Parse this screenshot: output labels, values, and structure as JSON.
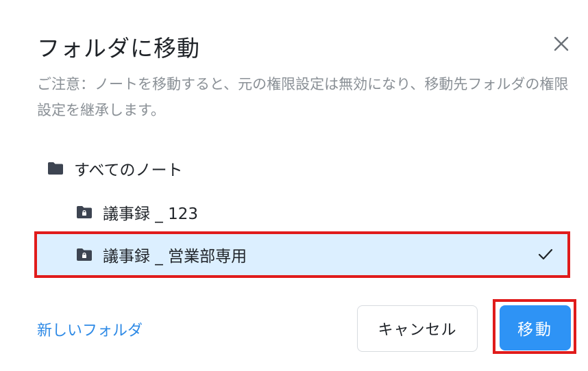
{
  "dialog": {
    "title": "フォルダに移動",
    "notice": "ご注意：ノートを移動すると、元の権限設定は無効になり、移動先フォルダの権限設定を継承します。"
  },
  "tree": {
    "root_label": "すべてのノート",
    "items": [
      {
        "label": "議事録 _ 123",
        "selected": false,
        "locked": true
      },
      {
        "label": "議事録 _ 営業部専用",
        "selected": true,
        "locked": true
      }
    ]
  },
  "footer": {
    "new_folder_label": "新しいフォルダ",
    "cancel_label": "キャンセル",
    "move_label": "移動"
  },
  "colors": {
    "primary": "#2e93f5",
    "selected_row_bg": "#dcefff",
    "highlight_red": "#e01b1b",
    "link": "#2e8ae6",
    "muted_text": "#8a9096",
    "folder_icon": "#3d4451"
  },
  "icons": {
    "close": "close-icon",
    "folder": "folder-icon",
    "locked_folder": "locked-folder-icon",
    "check": "check-icon"
  }
}
